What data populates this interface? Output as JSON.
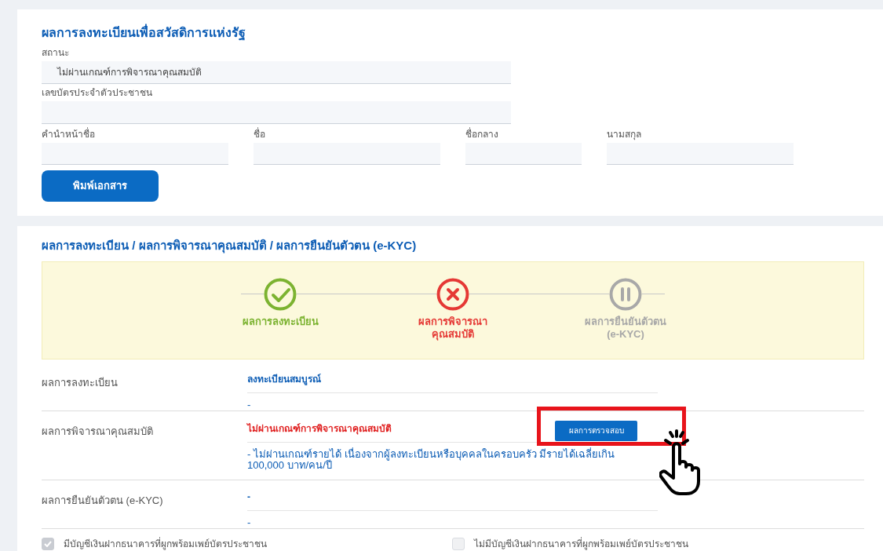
{
  "registration_card": {
    "title": "ผลการลงทะเบียนเพื่อสวัสดิการแห่งรัฐ",
    "fields": [
      {
        "label": "สถานะ",
        "value": "ไม่ผ่านเกณฑ์การพิจารณาคุณสมบัติ"
      },
      {
        "label": "เลขบัตรประจำตัวประชาชน"
      }
    ],
    "name_fields": [
      {
        "label": "คำนำหน้าชื่อ"
      },
      {
        "label": "ชื่อ"
      },
      {
        "label": "ชื่อกลาง"
      },
      {
        "label": "นามสกุล"
      }
    ],
    "print_button": "พิมพ์เอกสาร"
  },
  "results_card": {
    "title": "ผลการลงทะเบียน / ผลการพิจารณาคุณสมบัติ / ผลการยืนยันตัวตน (e-KYC)",
    "steps": [
      {
        "label": "ผลการลงทะเบียน",
        "kind": "success"
      },
      {
        "label": "ผลการพิจารณา\nคุณสมบัติ",
        "kind": "failed"
      },
      {
        "label": "ผลการยืนยันตัวตน\n(e-KYC)",
        "kind": "pending"
      }
    ],
    "rows": [
      {
        "label": "ผลการลงทะเบียน",
        "value": "ลงทะเบียนสมบูรณ์",
        "failed": false,
        "note": "-"
      },
      {
        "label": "ผลการพิจารณาคุณสมบัติ",
        "value": "ไม่ผ่านเกณฑ์การพิจารณาคุณสมบัติ",
        "failed": true,
        "note": "- ไม่ผ่านเกณฑ์รายได้ เนื่องจากผู้ลงทะเบียนหรือบุคคลในครอบครัว มีรายได้เฉลี่ยเกิน 100,000 บาท/คน/ปี",
        "button": "ผลการตรวจสอบ"
      },
      {
        "label": "ผลการยืนยันตัวตน (e-KYC)",
        "value": "-",
        "failed": false,
        "note": "-"
      }
    ],
    "checkboxes": [
      {
        "label": "มีบัญชีเงินฝากธนาคารที่ผูกพร้อมเพย์บัตรประชาชน",
        "checked": true
      },
      {
        "label": "ไม่มีบัญชีเงินฝากธนาคารที่ผูกพร้อมเพย์บัตรประชาชน",
        "checked": false
      }
    ]
  }
}
